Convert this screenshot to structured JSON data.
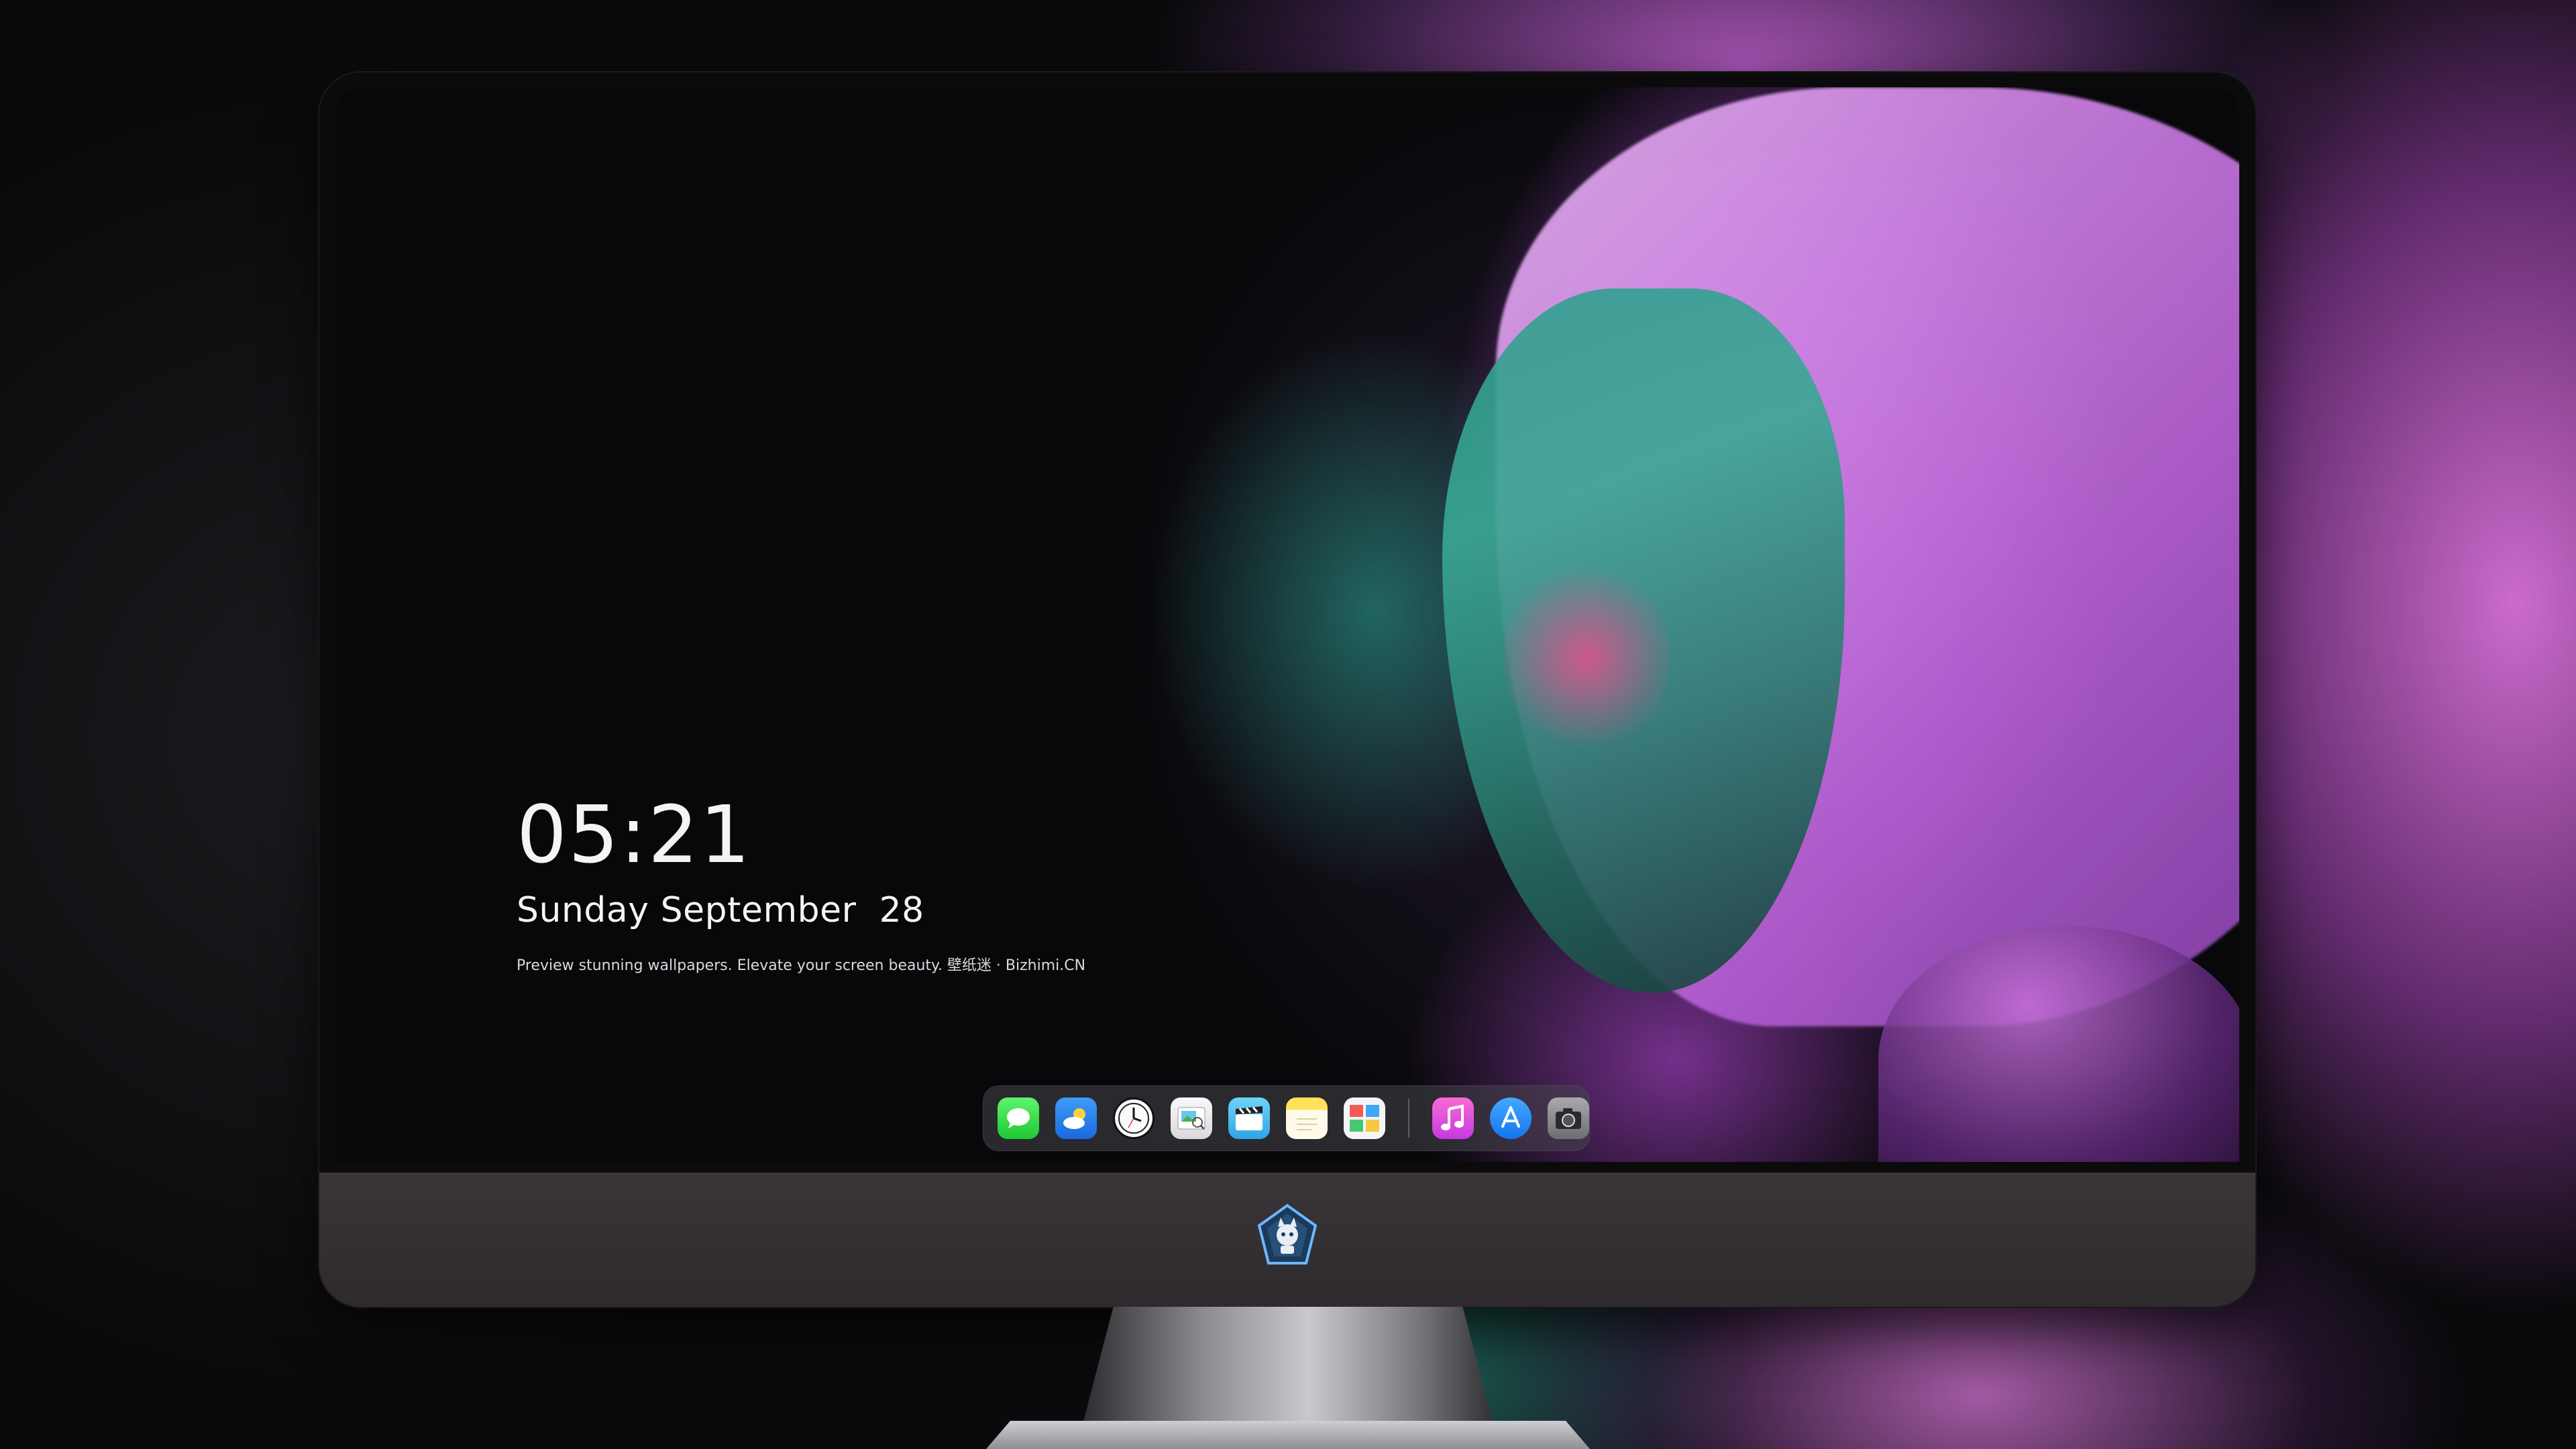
{
  "lock_screen": {
    "time": "05:21",
    "date": "Sunday September  28",
    "tagline": "Preview stunning wallpapers. Elevate your screen beauty. 壁纸迷 · Bizhimi.CN"
  },
  "dock": {
    "apps": [
      {
        "name": "messages",
        "icon": "message-bubble-icon",
        "color": "#28cd41"
      },
      {
        "name": "weather",
        "icon": "weather-cloud-sun-icon",
        "color": "#2b7ef0"
      },
      {
        "name": "clock",
        "icon": "clock-icon",
        "color": "#fafafa"
      },
      {
        "name": "preview",
        "icon": "preview-image-icon",
        "color": "#eeeeee"
      },
      {
        "name": "clips",
        "icon": "clapperboard-icon",
        "color": "#46bdf0"
      },
      {
        "name": "notes",
        "icon": "notes-icon",
        "color": "#ffe15a"
      },
      {
        "name": "photo-booth",
        "icon": "photo-collage-icon",
        "color": "#f5f5f5"
      },
      {
        "name": "music",
        "icon": "music-note-icon",
        "color": "#e15ad9"
      },
      {
        "name": "app-store",
        "icon": "app-store-a-icon",
        "color": "#1e8cf8"
      },
      {
        "name": "camera",
        "icon": "camera-icon",
        "color": "#8a8a8f"
      }
    ]
  },
  "colors": {
    "accent_pink": "#d784e6",
    "accent_teal": "#35a08e",
    "bezel": "#0b0b0c",
    "chin": "#353033"
  }
}
